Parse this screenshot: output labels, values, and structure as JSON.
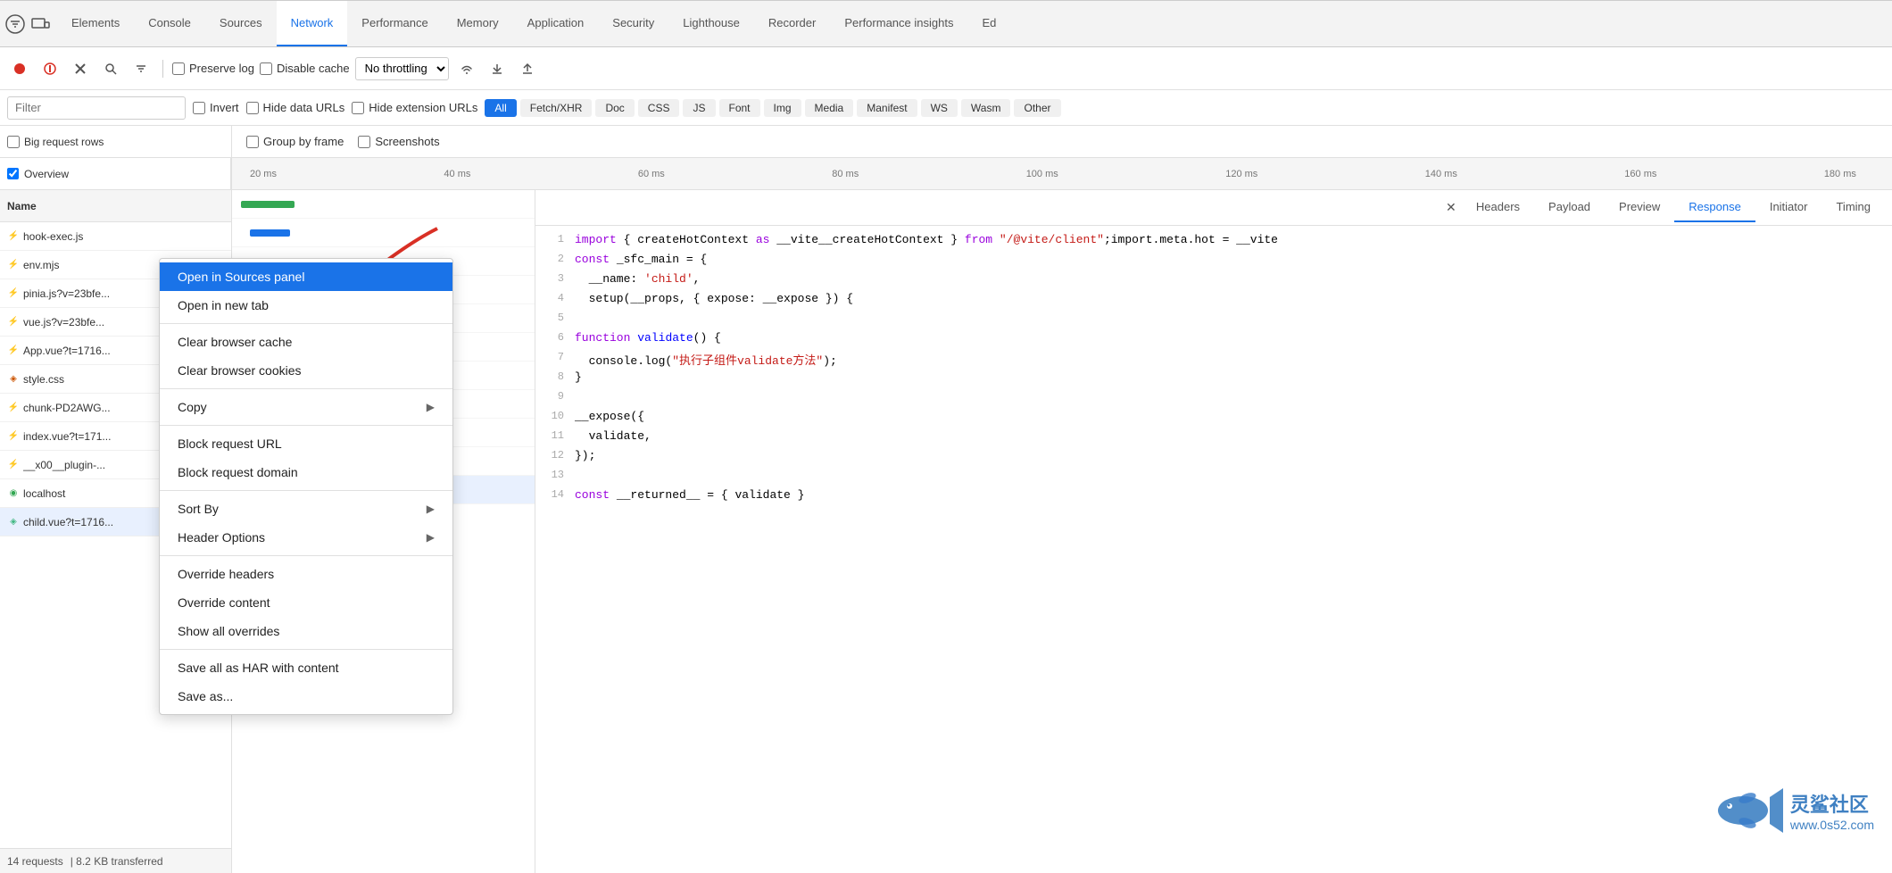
{
  "tabs": {
    "items": [
      {
        "label": "Elements",
        "active": false
      },
      {
        "label": "Console",
        "active": false
      },
      {
        "label": "Sources",
        "active": false
      },
      {
        "label": "Network",
        "active": true
      },
      {
        "label": "Performance",
        "active": false
      },
      {
        "label": "Memory",
        "active": false
      },
      {
        "label": "Application",
        "active": false
      },
      {
        "label": "Security",
        "active": false
      },
      {
        "label": "Lighthouse",
        "active": false
      },
      {
        "label": "Recorder",
        "active": false
      },
      {
        "label": "Performance insights",
        "active": false
      },
      {
        "label": "Ed",
        "active": false
      }
    ]
  },
  "toolbar": {
    "preserve_log": "Preserve log",
    "disable_cache": "Disable cache",
    "no_throttling": "No throttling"
  },
  "filter_bar": {
    "placeholder": "Filter",
    "invert_label": "Invert",
    "hide_data_urls": "Hide data URLs",
    "hide_extension_urls": "Hide extension URLs",
    "chips": [
      {
        "label": "All",
        "active": true
      },
      {
        "label": "Fetch/XHR",
        "active": false
      },
      {
        "label": "Doc",
        "active": false
      },
      {
        "label": "CSS",
        "active": false
      },
      {
        "label": "JS",
        "active": false
      },
      {
        "label": "Font",
        "active": false
      },
      {
        "label": "Img",
        "active": false
      },
      {
        "label": "Media",
        "active": false
      },
      {
        "label": "Manifest",
        "active": false
      },
      {
        "label": "WS",
        "active": false
      },
      {
        "label": "Wasm",
        "active": false
      },
      {
        "label": "Other",
        "active": false
      }
    ]
  },
  "options": {
    "big_rows": "Big request rows",
    "group_by_frame": "Group by frame",
    "overview": "Overview",
    "screenshots": "Screenshots"
  },
  "waterfall_ticks": [
    "20 ms",
    "40 ms",
    "60 ms",
    "80 ms",
    "100 ms",
    "120 ms",
    "140 ms",
    "160 ms",
    "180 ms"
  ],
  "requests": [
    {
      "icon": "js",
      "name": "hook-exec.js",
      "selected": false,
      "error": false
    },
    {
      "icon": "js",
      "name": "env.mjs",
      "selected": false,
      "error": false
    },
    {
      "icon": "js",
      "name": "pinia.js?v=23bfe...",
      "selected": false,
      "error": false
    },
    {
      "icon": "js",
      "name": "vue.js?v=23bfe...",
      "selected": false,
      "error": false
    },
    {
      "icon": "js",
      "name": "App.vue?t=1716...",
      "selected": false,
      "error": false
    },
    {
      "icon": "css",
      "name": "style.css",
      "selected": false,
      "error": false
    },
    {
      "icon": "js",
      "name": "chunk-PD2AWG...",
      "selected": false,
      "error": false
    },
    {
      "icon": "js",
      "name": "index.vue?t=171...",
      "selected": false,
      "error": false
    },
    {
      "icon": "js",
      "name": "__x00__plugin-...",
      "selected": false,
      "error": false
    },
    {
      "icon": "net",
      "name": "localhost",
      "selected": false,
      "error": false
    },
    {
      "icon": "vue",
      "name": "child.vue?t=1716...",
      "selected": true,
      "error": false
    }
  ],
  "status_bar": {
    "requests": "14 requests",
    "size": "8.2"
  },
  "response_tabs": [
    {
      "label": "Headers",
      "active": false
    },
    {
      "label": "Payload",
      "active": false
    },
    {
      "label": "Preview",
      "active": false
    },
    {
      "label": "Response",
      "active": true
    },
    {
      "label": "Initiator",
      "active": false
    },
    {
      "label": "Timing",
      "active": false
    }
  ],
  "code_lines": [
    {
      "num": 1,
      "content": "import { createHotContext as __vite__createHotContext } from \"/@vite/client\";import.meta.hot = __vite"
    },
    {
      "num": 2,
      "content": "const _sfc_main = {"
    },
    {
      "num": 3,
      "content": "  __name: 'child',"
    },
    {
      "num": 4,
      "content": "  setup(__props, { expose: __expose }) {"
    },
    {
      "num": 5,
      "content": ""
    },
    {
      "num": 6,
      "content": "function validate() {"
    },
    {
      "num": 7,
      "content": "  console.log(\"执行子组件validate方法\");"
    },
    {
      "num": 8,
      "content": "}"
    },
    {
      "num": 9,
      "content": ""
    },
    {
      "num": 10,
      "content": "__expose({"
    },
    {
      "num": 11,
      "content": "  validate,"
    },
    {
      "num": 12,
      "content": "});"
    },
    {
      "num": 13,
      "content": ""
    },
    {
      "num": 14,
      "content": "const __returned__ = { validate }"
    }
  ],
  "context_menu": {
    "items": [
      {
        "label": "Open in Sources panel",
        "active": true,
        "arrow": false
      },
      {
        "label": "Open in new tab",
        "active": false,
        "arrow": false
      },
      {
        "label": "Clear browser cache",
        "active": false,
        "arrow": false
      },
      {
        "label": "Clear browser cookies",
        "active": false,
        "arrow": false
      },
      {
        "label": "Copy",
        "active": false,
        "arrow": true
      },
      {
        "label": "Block request URL",
        "active": false,
        "arrow": false
      },
      {
        "label": "Block request domain",
        "active": false,
        "arrow": false
      },
      {
        "label": "Sort By",
        "active": false,
        "arrow": true
      },
      {
        "label": "Header Options",
        "active": false,
        "arrow": true
      },
      {
        "label": "Override headers",
        "active": false,
        "arrow": false
      },
      {
        "label": "Override content",
        "active": false,
        "arrow": false
      },
      {
        "label": "Show all overrides",
        "active": false,
        "arrow": false
      },
      {
        "label": "Save all as HAR with content",
        "active": false,
        "arrow": false
      },
      {
        "label": "Save as...",
        "active": false,
        "arrow": false
      }
    ]
  },
  "watermark": {
    "site": "www.0s52.com"
  },
  "colors": {
    "active_tab": "#1a73e8",
    "active_chip": "#1a73e8",
    "context_active": "#1a73e8",
    "arrow_red": "#d93025"
  }
}
